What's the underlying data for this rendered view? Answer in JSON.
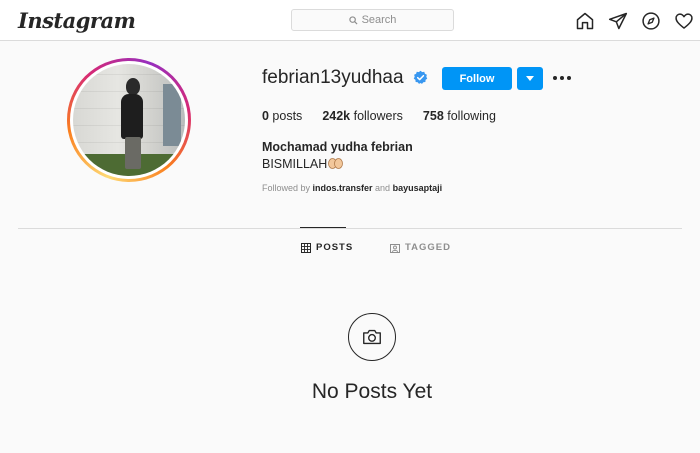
{
  "header": {
    "logo": "Instagram",
    "search_placeholder": "Search",
    "nav_icons": [
      "home-icon",
      "direct-icon",
      "explore-icon",
      "activity-icon"
    ]
  },
  "profile": {
    "username": "febrian13yudhaa",
    "verified": true,
    "follow_label": "Follow",
    "stats": {
      "posts_count": "0",
      "posts_label": " posts",
      "followers_count": "242k",
      "followers_label": " followers",
      "following_count": "758",
      "following_label": " following"
    },
    "full_name": "Mochamad yudha febrian",
    "bio": "BISMILLAH",
    "followed_by": {
      "prefix": "Followed by ",
      "user1": "indos.transfer",
      "conjunction": " and ",
      "user2": "bayusaptaji"
    }
  },
  "tabs": [
    {
      "label": "POSTS",
      "active": true
    },
    {
      "label": "TAGGED",
      "active": false
    }
  ],
  "empty_state": {
    "text": "No Posts Yet"
  },
  "colors": {
    "accent": "#0095f6",
    "verified": "#3897f0",
    "border": "#dbdbdb",
    "background": "#fafafa"
  }
}
